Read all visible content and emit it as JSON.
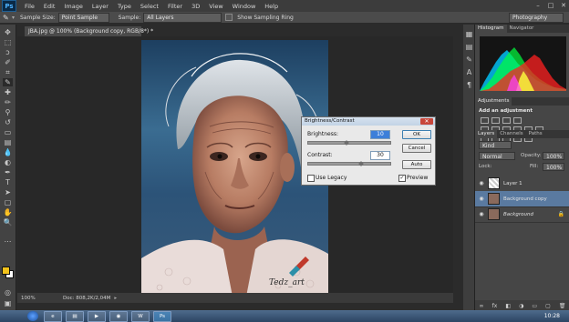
{
  "menu": {
    "logo": "Ps",
    "items": [
      "File",
      "Edit",
      "Image",
      "Layer",
      "Type",
      "Select",
      "Filter",
      "3D",
      "View",
      "Window",
      "Help"
    ]
  },
  "options": {
    "sample_size_label": "Sample Size:",
    "sample_size_value": "Point Sample",
    "sample_label": "Sample:",
    "sample_value": "All Layers",
    "show_ring_label": "Show Sampling Ring",
    "workspace": "Photography"
  },
  "document": {
    "tab_title": "JBA.jpg @ 100% (Background copy, RGB/8*) *",
    "zoom": "100%",
    "doc_info": "Doc: 808,2K/2,04M",
    "watermark": "Tedz_art"
  },
  "dialog": {
    "title": "Brightness/Contrast",
    "brightness_label": "Brightness:",
    "brightness_value": "10",
    "contrast_label": "Contrast:",
    "contrast_value": "30",
    "ok": "OK",
    "cancel": "Cancel",
    "auto": "Auto",
    "legacy_label": "Use Legacy",
    "preview_label": "Preview"
  },
  "panels": {
    "histogram_tab": "Histogram",
    "navigator_tab": "Navigator",
    "adjustments_tab": "Adjustments",
    "add_adjustment": "Add an adjustment",
    "layers_tab": "Layers",
    "channels_tab": "Channels",
    "paths_tab": "Paths",
    "kind_label": "Kind",
    "blend_mode": "Normal",
    "opacity_label": "Opacity:",
    "opacity_value": "100%",
    "lock_label": "Lock:",
    "fill_label": "Fill:",
    "fill_value": "100%",
    "layers": [
      "Layer 1",
      "Background copy",
      "Background"
    ]
  },
  "taskbar": {
    "clock": "10:28",
    "buttons": [
      "W",
      "Ps"
    ]
  },
  "colors": {
    "foreground": "#f2c21b",
    "background": "#ffffff",
    "accent": "#1f5f94"
  }
}
